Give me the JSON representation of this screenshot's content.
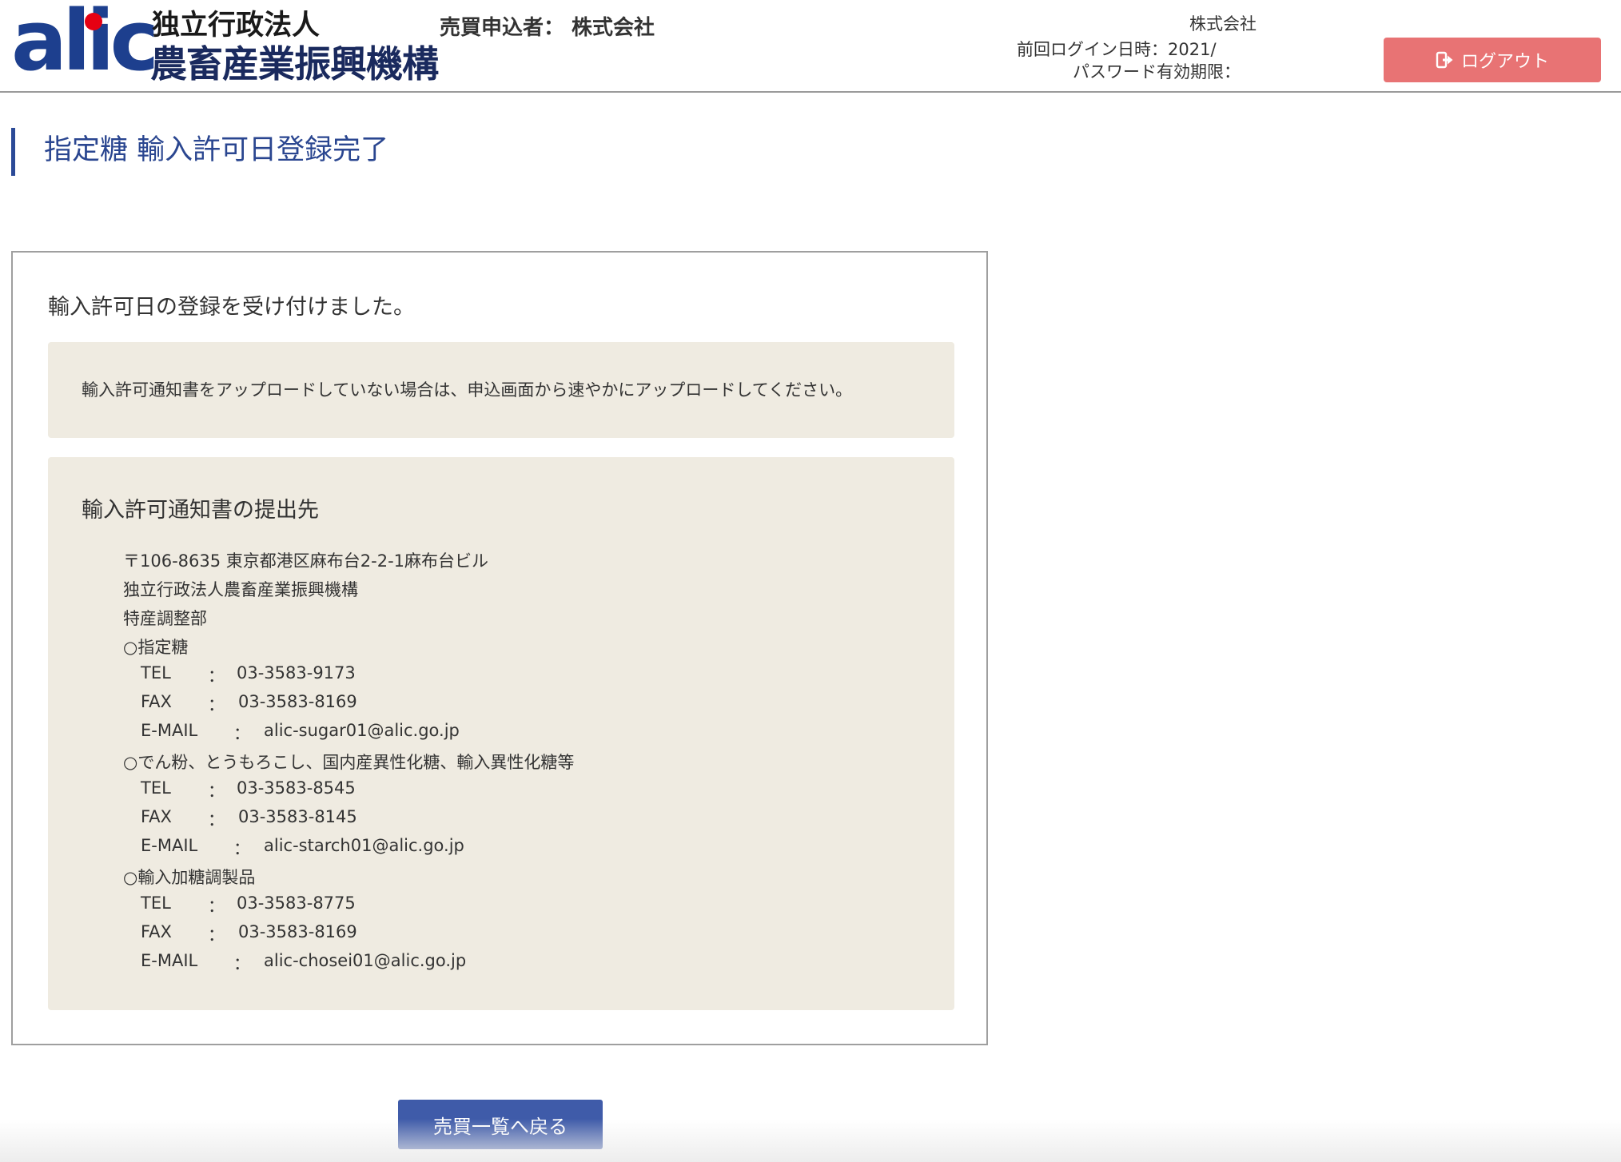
{
  "header": {
    "logo_word": "alic",
    "logo_line1": "独立行政法人",
    "logo_line2": "農畜産業振興機構",
    "applicant": "売買申込者： 株式会社",
    "user_company": "株式会社",
    "last_login": "前回ログイン日時：2021/",
    "password_expiry": "パスワード有効期限：",
    "logout_label": "ログアウト"
  },
  "page": {
    "title": "指定糖 輸入許可日登録完了"
  },
  "main": {
    "done_message": "輸入許可日の登録を受け付けました。",
    "notice": "輸入許可通知書をアップロードしていない場合は、申込画面から速やかにアップロードしてください。",
    "destination": {
      "title": "輸入許可通知書の提出先",
      "address_lines": [
        "〒106-8635 東京都港区麻布台2-2-1麻布台ビル",
        "独立行政法人農畜産業振興機構",
        "特産調整部"
      ],
      "sections": [
        {
          "heading": "○指定糖",
          "tel_label": "TEL",
          "tel": "03-3583-9173",
          "fax_label": "FAX",
          "fax": "03-3583-8169",
          "mail_label": "E-MAIL",
          "mail": "alic-sugar01@alic.go.jp"
        },
        {
          "heading": "○でん粉、とうもろこし、国内産異性化糖、輸入異性化糖等",
          "tel_label": "TEL",
          "tel": "03-3583-8545",
          "fax_label": "FAX",
          "fax": "03-3583-8145",
          "mail_label": "E-MAIL",
          "mail": "alic-starch01@alic.go.jp"
        },
        {
          "heading": "○輸入加糖調製品",
          "tel_label": "TEL",
          "tel": "03-3583-8775",
          "fax_label": "FAX",
          "fax": "03-3583-8169",
          "mail_label": "E-MAIL",
          "mail": "alic-chosei01@alic.go.jp"
        }
      ],
      "colon": "："
    }
  },
  "footer": {
    "back_label": "売買一覧へ戻る"
  },
  "colors": {
    "brand_blue": "#1d3f8e",
    "logo_red": "#e60012",
    "logout_red": "#e87374",
    "button_blue": "#3f5ba9",
    "panel_beige": "#efebe1"
  }
}
